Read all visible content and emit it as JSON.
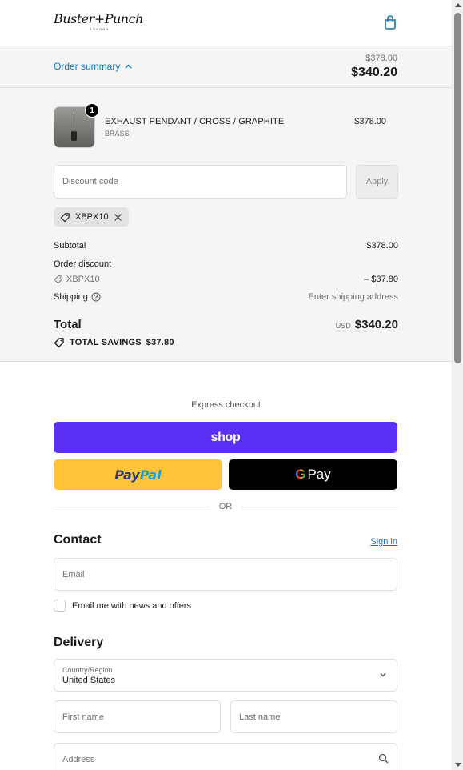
{
  "header": {
    "logo_text": "Buster+Punch",
    "logo_sub": "LONDON",
    "cart_icon": "shopping-bag-icon"
  },
  "summary_bar": {
    "toggle_label": "Order summary",
    "original_total": "$378.00",
    "total": "$340.20"
  },
  "order": {
    "product": {
      "name": "EXHAUST PENDANT / CROSS / GRAPHITE",
      "variant": "BRASS",
      "quantity": "1",
      "price": "$378.00"
    },
    "discount": {
      "placeholder": "Discount code",
      "apply_label": "Apply",
      "applied_code": "XBPX10"
    },
    "subtotal_label": "Subtotal",
    "subtotal_value": "$378.00",
    "order_discount_label": "Order discount",
    "order_discount_code": "XBPX10",
    "order_discount_value": "– $37.80",
    "shipping_label": "Shipping",
    "shipping_value": "Enter shipping address",
    "total_label": "Total",
    "total_currency": "USD",
    "total_value": "$340.20",
    "savings_label": "TOTAL SAVINGS",
    "savings_value": "$37.80"
  },
  "express": {
    "label": "Express checkout",
    "shop_label": "shop",
    "paypal_label_1": "Pay",
    "paypal_label_2": "Pal",
    "gpay_g": "G",
    "gpay_label": "Pay",
    "or_label": "OR"
  },
  "contact": {
    "title": "Contact",
    "sign_in": "Sign in",
    "email_placeholder": "Email",
    "news_label": "Email me with news and offers"
  },
  "delivery": {
    "title": "Delivery",
    "country_label": "Country/Region",
    "country_value": "United States",
    "first_name_placeholder": "First name",
    "last_name_placeholder": "Last name",
    "address_placeholder": "Address"
  },
  "colors": {
    "accent": "#1773b0",
    "shop": "#5a31f4",
    "paypal": "#ffc439",
    "gpay": "#000000"
  }
}
